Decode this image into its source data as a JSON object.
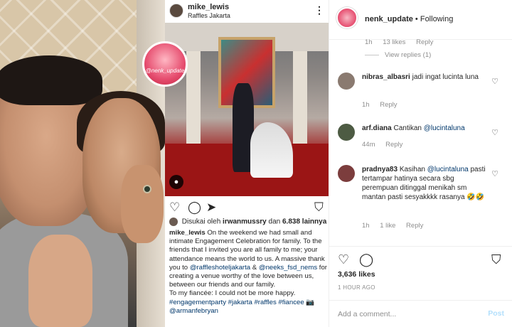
{
  "left_photo": {
    "badge_text": "@nenk_update"
  },
  "post": {
    "username": "mike_lewis",
    "location": "Raffles Jakarta",
    "more_icon": "⋮",
    "user_tag_icon": "●",
    "likes": {
      "prefix": "Disukai oleh",
      "user": "irwanmussry",
      "conjunction": "dan",
      "count": "6.838 lainnya"
    },
    "caption": {
      "username": "mike_lewis",
      "text1": "On the weekend we had small and intimate Engagement Celebration for family. To the friends that I invited you are all family to me; your attendance means the world to us. A massive thank you to ",
      "mention1": "@raffleshoteljakarta",
      "text2": " & ",
      "mention2": "@neeks_fsd_nems",
      "text3": " for creating a venue worthy of the love between us, between our friends and our family.",
      "text4": "To my fiancée: I could not be more happy.",
      "hashtags": "#engagementparty #jakarta #raffles #fiancee",
      "camera": "📷",
      "mention3": "@armanfebryan"
    }
  },
  "comments_panel": {
    "header": {
      "username": "nenk_update",
      "dot": "•",
      "follow_state": "Following"
    },
    "top_meta": {
      "time": "1h",
      "likes": "13 likes",
      "reply": "Reply"
    },
    "view_replies": "View replies (1)",
    "comments": [
      {
        "user": "nibras_albasri",
        "text": "jadi ingat lucinta luna",
        "time": "1h",
        "reply": "Reply"
      },
      {
        "user": "arf.diana",
        "text": "Cantikan ",
        "mention": "@lucintaluna",
        "time": "44m",
        "reply": "Reply"
      },
      {
        "user": "pradnya83",
        "text": "Kasihan ",
        "mention": "@lucintaluna",
        "text2": " pasti tertampar hatinya secara sbg perempuan ditinggal menikah sm mantan pasti sesyakkkk rasanya 🤣🤣",
        "time": "1h",
        "likes": "1 like",
        "reply": "Reply"
      }
    ],
    "like_count": "3,636 likes",
    "timestamp": "1 HOUR AGO",
    "add_comment_placeholder": "Add a comment...",
    "post_button": "Post"
  },
  "icons": {
    "heart": "♡",
    "comment": "◯",
    "share": "➤",
    "bookmark": "⛉",
    "comment_heart": "♡"
  },
  "colors": {
    "link": "#00376b",
    "muted": "#8e8e8e",
    "post_button": "#b2dffc"
  }
}
